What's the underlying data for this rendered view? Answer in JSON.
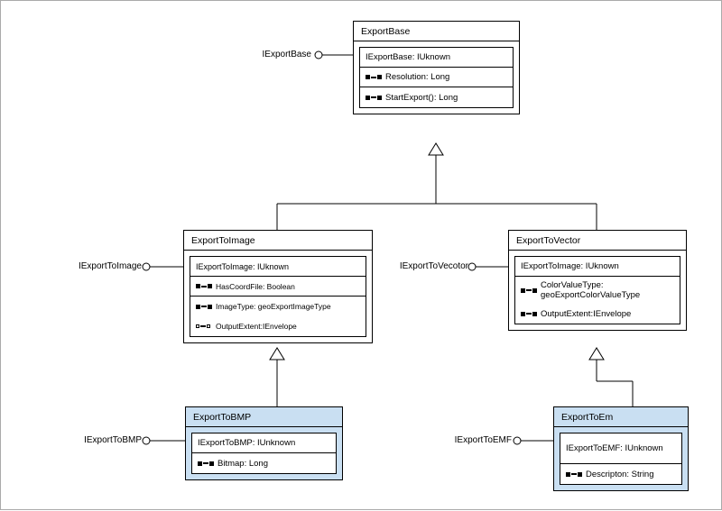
{
  "chart_data": {
    "type": "uml-class-diagram",
    "classes": [
      {
        "id": "ExportBase",
        "stereotype": null,
        "lollipop": "IExportBase",
        "abstract": true,
        "compartments": [
          [
            "IExportBase: IUknown"
          ],
          [
            "Resolution: Long",
            "StartExport(): Long"
          ]
        ],
        "fill": "white"
      },
      {
        "id": "ExportToImage",
        "lollipop": "IExportToImage",
        "abstract": true,
        "compartments": [
          [
            "IExportToImage: IUknown"
          ],
          [
            "HasCoordFile: Boolean",
            "ImageType: geoExportImageType",
            "OutputExtent:IEnvelope"
          ]
        ],
        "fill": "white"
      },
      {
        "id": "ExportToVector",
        "lollipop": "IExportToVecotor",
        "abstract": true,
        "compartments": [
          [
            "IExportToImage: IUknown"
          ],
          [
            "ColorValueType: geoExportColorValueType",
            "OutputExtent:IEnvelope"
          ]
        ],
        "fill": "white"
      },
      {
        "id": "ExportToBMP",
        "lollipop": "IExportToBMP",
        "abstract": false,
        "compartments": [
          [
            "IExportToBMP: IUnknown"
          ],
          [
            "Bitmap: Long"
          ]
        ],
        "fill": "#c9dff2"
      },
      {
        "id": "ExportToEm",
        "lollipop": "IExportToEMF",
        "abstract": false,
        "compartments": [
          [
            "IExportToEMF: IUnknown"
          ],
          [
            "Descripton: String"
          ]
        ],
        "fill": "#c9dff2"
      }
    ],
    "generalizations": [
      {
        "child": "ExportToImage",
        "parent": "ExportBase"
      },
      {
        "child": "ExportToVector",
        "parent": "ExportBase"
      },
      {
        "child": "ExportToBMP",
        "parent": "ExportToImage"
      },
      {
        "child": "ExportToEm",
        "parent": "ExportToVector"
      }
    ]
  },
  "exportBase": {
    "title": "ExportBase",
    "lollipop": "IExportBase",
    "r0": "IExportBase: IUknown",
    "r1": "Resolution: Long",
    "r2": "StartExport(): Long"
  },
  "exportToImage": {
    "title": "ExportToImage",
    "lollipop": "IExportToImage",
    "r0": "IExportToImage: IUknown",
    "r1": "HasCoordFile: Boolean",
    "r2": "ImageType: geoExportImageType",
    "r3": "OutputExtent:IEnvelope"
  },
  "exportToVector": {
    "title": "ExportToVector",
    "lollipop": "IExportToVecotor",
    "r0": "IExportToImage: IUknown",
    "r1": "ColorValueType: geoExportColorValueType",
    "r2": "OutputExtent:IEnvelope"
  },
  "exportToBMP": {
    "title": "ExportToBMP",
    "lollipop": "IExportToBMP",
    "r0": "IExportToBMP: IUnknown",
    "r1": "Bitmap: Long"
  },
  "exportToEm": {
    "title": "ExportToEm",
    "lollipop": "IExportToEMF",
    "r0": "IExportToEMF: IUnknown",
    "r1": "Descripton: String"
  }
}
